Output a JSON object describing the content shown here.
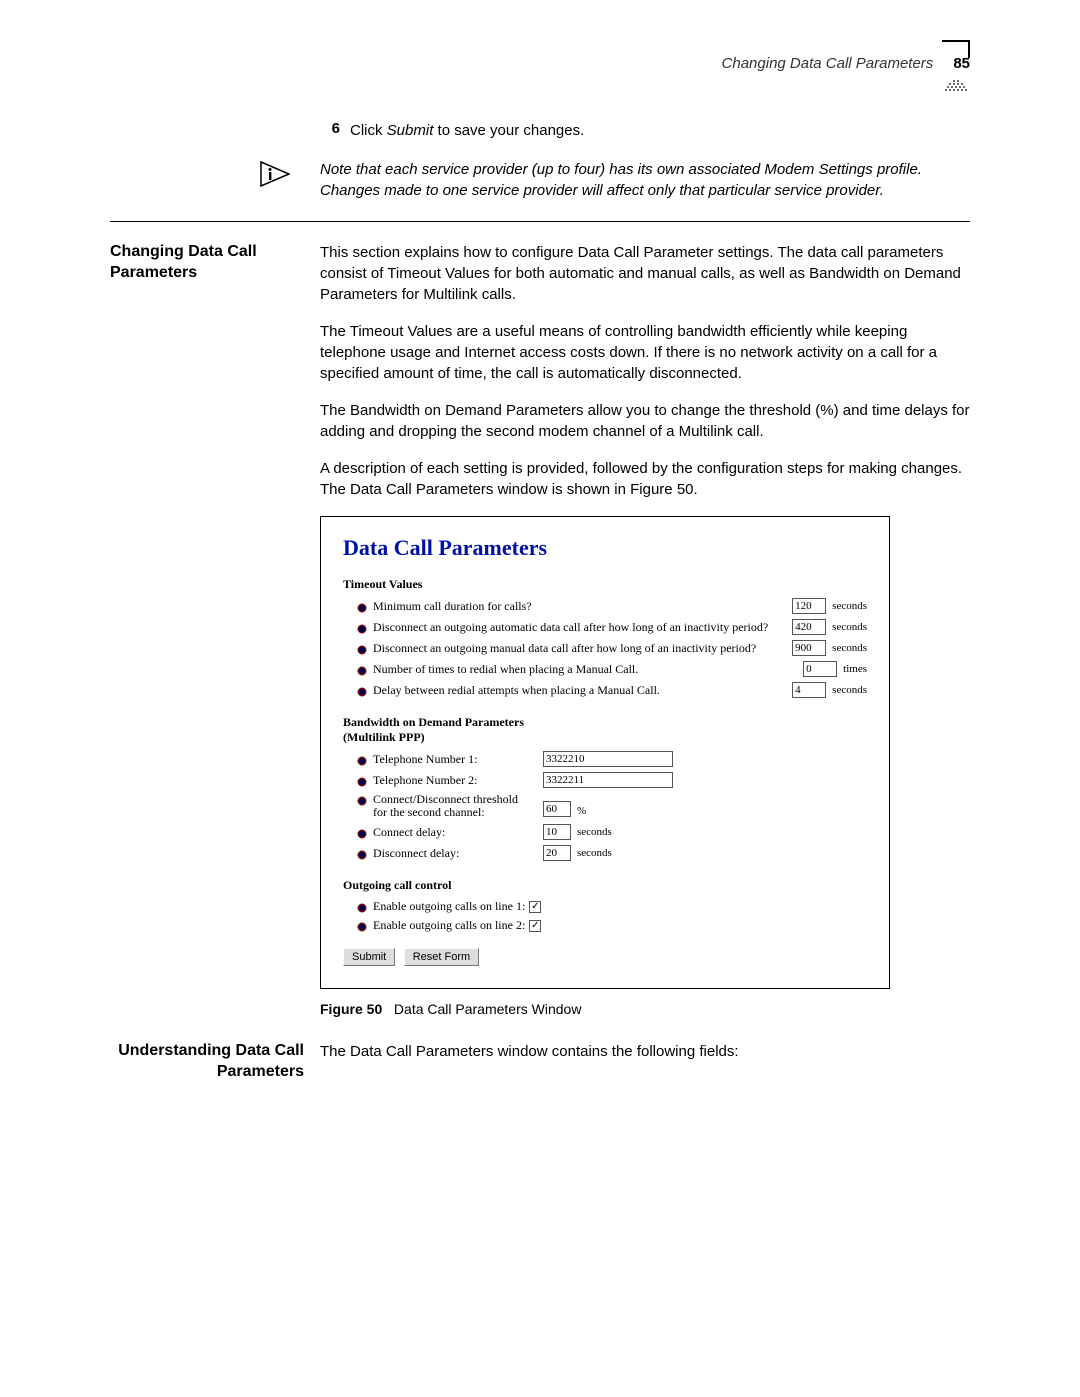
{
  "header": {
    "title": "Changing Data Call Parameters",
    "page_number": "85"
  },
  "step": {
    "num": "6",
    "text_pre": "Click ",
    "text_em": "Submit",
    "text_post": " to save your changes."
  },
  "note": {
    "text": "Note that each service provider (up to four) has its own associated Modem Settings profile. Changes made to one service provider will affect only that particular service provider."
  },
  "section1": {
    "heading": "Changing Data Call Parameters",
    "p1": "This section explains how to configure Data Call Parameter settings. The data call parameters consist of Timeout Values for both automatic and manual calls, as well as Bandwidth on Demand Parameters for Multilink calls.",
    "p2": "The Timeout Values are a useful means of controlling bandwidth efficiently while keeping telephone usage and Internet access costs down. If there is no network activity on a call for a specified amount of time, the call is automatically disconnected.",
    "p3": "The Bandwidth on Demand Parameters allow you to change the threshold (%) and time delays for adding and dropping the second modem channel of a Multilink call.",
    "p4": "A description of each setting is provided, followed by the configuration steps for making changes. The Data Call Parameters window is shown in Figure 50."
  },
  "window": {
    "title": "Data Call Parameters",
    "timeout_label": "Timeout Values",
    "rows": {
      "min_call": {
        "label": "Minimum call duration for calls?",
        "value": "120",
        "unit": "seconds"
      },
      "auto_disc": {
        "label": "Disconnect an outgoing automatic data call after how long of an inactivity period?",
        "value": "420",
        "unit": "seconds"
      },
      "manual_disc": {
        "label": "Disconnect an outgoing manual data call after how long of an inactivity period?",
        "value": "900",
        "unit": "seconds"
      },
      "redial_times": {
        "label": "Number of times to redial when placing a Manual Call.",
        "value": "0",
        "unit": "times"
      },
      "redial_delay": {
        "label": "Delay between redial attempts when placing a Manual Call.",
        "value": "4",
        "unit": "seconds"
      }
    },
    "bod_label1": "Bandwidth on Demand Parameters",
    "bod_label2": "(Multilink PPP)",
    "bod": {
      "tel1": {
        "label": "Telephone Number 1:",
        "value": "3322210"
      },
      "tel2": {
        "label": "Telephone Number 2:",
        "value": "3322211"
      },
      "thresh": {
        "label1": "Connect/Disconnect threshold",
        "label2": "for the second channel:",
        "value": "60",
        "unit": "%"
      },
      "cdelay": {
        "label": "Connect delay:",
        "value": "10",
        "unit": "seconds"
      },
      "ddelay": {
        "label": "Disconnect delay:",
        "value": "20",
        "unit": "seconds"
      }
    },
    "occ_label": "Outgoing call control",
    "occ": {
      "line1": "Enable outgoing calls on line 1:",
      "line2": "Enable outgoing calls on line 2:",
      "check": "✓"
    },
    "submit": "Submit",
    "reset": "Reset Form"
  },
  "figure": {
    "label": "Figure 50",
    "text": "Data Call Parameters Window"
  },
  "section2": {
    "heading": "Understanding Data Call Parameters",
    "p1": "The Data Call Parameters window contains the following fields:"
  }
}
